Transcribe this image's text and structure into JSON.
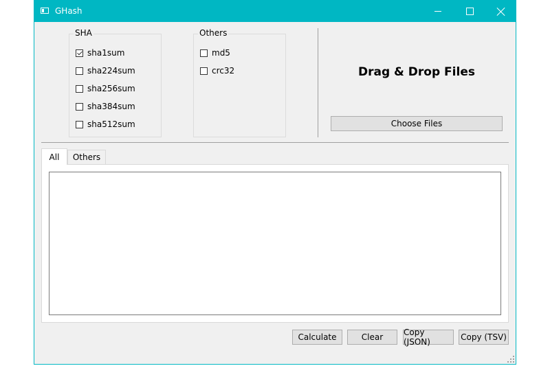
{
  "window": {
    "title": "GHash"
  },
  "sha_group": {
    "legend": "SHA",
    "items": [
      {
        "label": "sha1sum",
        "checked": true
      },
      {
        "label": "sha224sum",
        "checked": false
      },
      {
        "label": "sha256sum",
        "checked": false
      },
      {
        "label": "sha384sum",
        "checked": false
      },
      {
        "label": "sha512sum",
        "checked": false
      }
    ]
  },
  "others_group": {
    "legend": "Others",
    "items": [
      {
        "label": "md5",
        "checked": false
      },
      {
        "label": "crc32",
        "checked": false
      }
    ]
  },
  "drop": {
    "label": "Drag & Drop Files",
    "choose_button": "Choose Files"
  },
  "tabs": [
    {
      "label": "All",
      "active": true
    },
    {
      "label": "Others",
      "active": false
    }
  ],
  "output": {
    "value": ""
  },
  "actions": {
    "calculate": "Calculate",
    "clear": "Clear",
    "copy_json": "Copy (JSON)",
    "copy_tsv": "Copy (TSV)"
  },
  "colors": {
    "titlebar": "#00b7c3",
    "window_bg": "#f0f0f0",
    "button_bg": "#e1e1e1"
  }
}
